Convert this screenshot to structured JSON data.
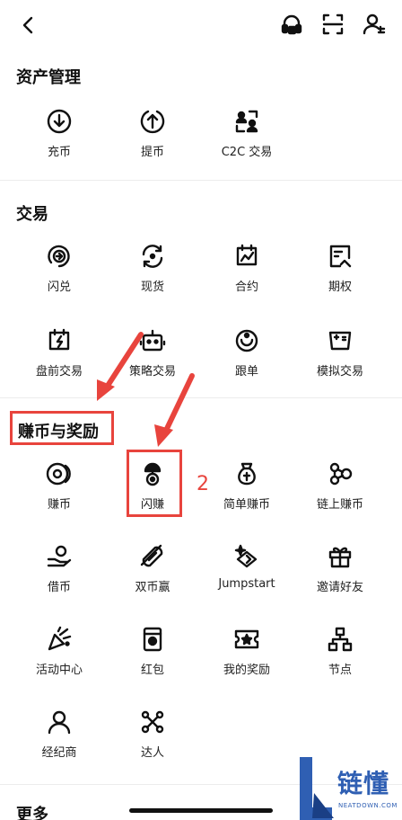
{
  "header": {
    "back_icon": "back-chevron-icon",
    "actions": [
      "headset-support-icon",
      "scan-icon",
      "user-settings-icon"
    ]
  },
  "sections": {
    "asset_management": {
      "title": "资产管理",
      "items": [
        {
          "label": "充币",
          "icon": "deposit-icon"
        },
        {
          "label": "提币",
          "icon": "withdraw-icon"
        },
        {
          "label": "C2C 交易",
          "icon": "c2c-icon"
        }
      ]
    },
    "trade": {
      "title": "交易",
      "items": [
        {
          "label": "闪兑",
          "icon": "convert-icon"
        },
        {
          "label": "现货",
          "icon": "spot-icon"
        },
        {
          "label": "合约",
          "icon": "futures-icon"
        },
        {
          "label": "期权",
          "icon": "options-icon"
        },
        {
          "label": "盘前交易",
          "icon": "premarket-icon"
        },
        {
          "label": "策略交易",
          "icon": "bot-icon"
        },
        {
          "label": "跟单",
          "icon": "copy-trade-icon"
        },
        {
          "label": "模拟交易",
          "icon": "demo-trade-icon"
        }
      ]
    },
    "earn_rewards": {
      "title": "赚币与奖励",
      "items": [
        {
          "label": "赚币",
          "icon": "earn-icon"
        },
        {
          "label": "闪赚",
          "icon": "flash-earn-icon"
        },
        {
          "label": "简单赚币",
          "icon": "simple-earn-icon"
        },
        {
          "label": "链上赚币",
          "icon": "onchain-earn-icon"
        },
        {
          "label": "借币",
          "icon": "loan-icon"
        },
        {
          "label": "双币赢",
          "icon": "dual-currency-icon"
        },
        {
          "label": "Jumpstart",
          "icon": "jumpstart-icon"
        },
        {
          "label": "邀请好友",
          "icon": "gift-icon"
        },
        {
          "label": "活动中心",
          "icon": "party-icon"
        },
        {
          "label": "红包",
          "icon": "red-packet-icon"
        },
        {
          "label": "我的奖励",
          "icon": "reward-ticket-icon"
        },
        {
          "label": "节点",
          "icon": "node-icon"
        },
        {
          "label": "经纪商",
          "icon": "broker-icon"
        },
        {
          "label": "达人",
          "icon": "expert-icon"
        }
      ]
    },
    "more": {
      "title": "更多"
    }
  },
  "annotation": {
    "step_number": "2",
    "color": "#e8443d"
  },
  "watermark": {
    "text": "链懂",
    "sub": "NEATDOWN.COM",
    "color": "#2f5fb3"
  }
}
